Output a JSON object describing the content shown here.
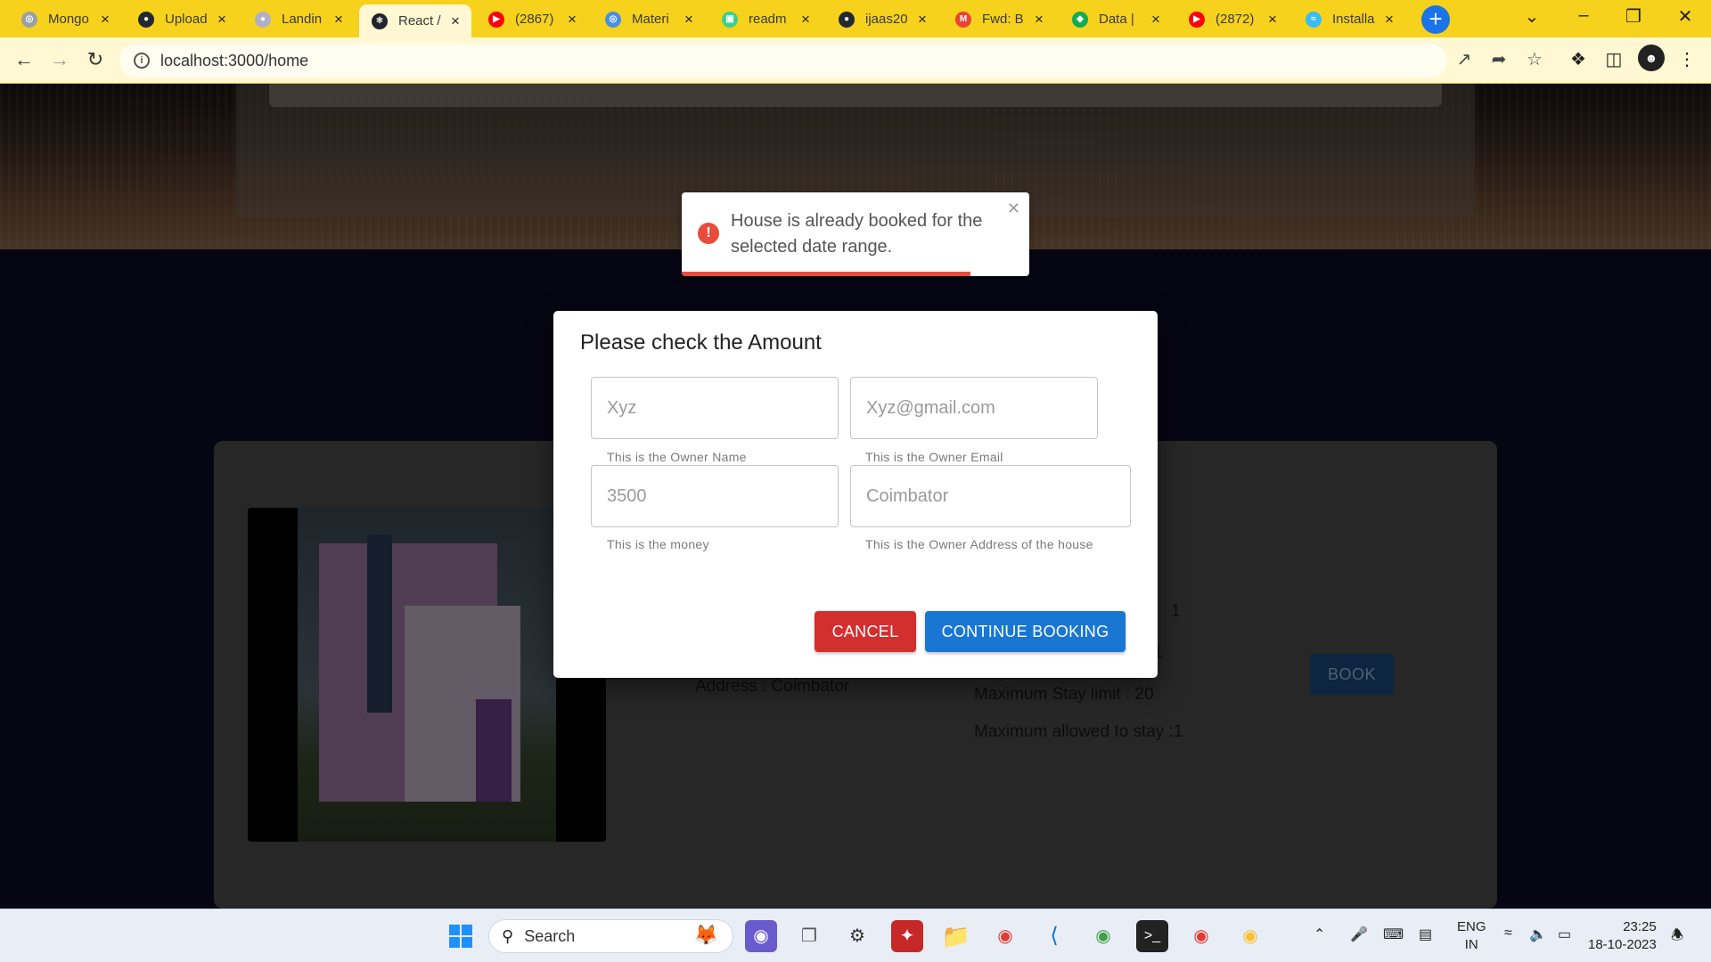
{
  "browser": {
    "tabs": [
      {
        "title": "Mongo",
        "color": "#9aa0a6",
        "glyph": "◎",
        "active": false
      },
      {
        "title": "Upload",
        "color": "#24292f",
        "glyph": "●",
        "active": false
      },
      {
        "title": "Landin",
        "color": "#b0b0c8",
        "glyph": "●",
        "active": false
      },
      {
        "title": "React /",
        "color": "#20232a",
        "glyph": "⚛",
        "active": true
      },
      {
        "title": "(2867)",
        "color": "#ff0000",
        "glyph": "▶",
        "active": false
      },
      {
        "title": "Materi",
        "color": "#4a90e2",
        "glyph": "◎",
        "active": false
      },
      {
        "title": "readm",
        "color": "#3ecf8e",
        "glyph": "▣",
        "active": false
      },
      {
        "title": "ijaas20",
        "color": "#24292f",
        "glyph": "●",
        "active": false
      },
      {
        "title": "Fwd: B",
        "color": "#ea4335",
        "glyph": "M",
        "active": false
      },
      {
        "title": "Data |",
        "color": "#13aa52",
        "glyph": "◆",
        "active": false
      },
      {
        "title": "(2872)",
        "color": "#ff0000",
        "glyph": "▶",
        "active": false
      },
      {
        "title": "Installa",
        "color": "#38bdf8",
        "glyph": "≈",
        "active": false
      }
    ],
    "url": "localhost:3000/home"
  },
  "toast": {
    "message": "House is already booked for the selected date range.",
    "progress": 0.83
  },
  "dialog": {
    "title": "Please check the Amount",
    "fields": {
      "owner_name": {
        "placeholder": "Xyz",
        "helper": "This is the Owner Name"
      },
      "owner_email": {
        "placeholder": "Xyz@gmail.com",
        "helper": "This is the Owner Email"
      },
      "money": {
        "placeholder": "3500",
        "helper": "This is the money"
      },
      "address": {
        "placeholder": "Coimbator",
        "helper": "This is the Owner Address of the house"
      }
    },
    "cancel_label": "CANCEL",
    "continue_label": "CONTINUE BOOKING"
  },
  "listing": {
    "address": "Address : Coimbator",
    "partial_value": "1",
    "partial_value2": "1",
    "max_stay": "Maximum Stay limit : 20",
    "max_allowed": "Maximum allowed to stay :1",
    "book_label": "BOOK"
  },
  "taskbar": {
    "search_label": "Search",
    "lang_line1": "ENG",
    "lang_line2": "IN",
    "time": "23:25",
    "date": "18-10-2023"
  }
}
